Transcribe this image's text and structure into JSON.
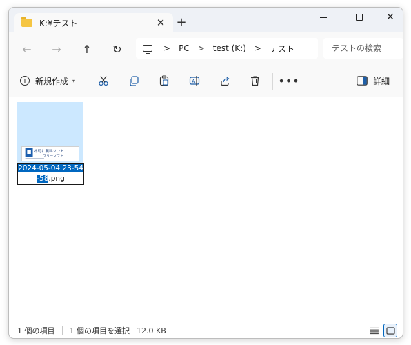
{
  "window": {
    "tab_title": "K:¥テスト",
    "close_tab_glyph": "✕",
    "new_tab_glyph": "+"
  },
  "nav": {
    "back_glyph": "←",
    "forward_glyph": "→",
    "up_glyph": "↑",
    "refresh_glyph": "↻",
    "breadcrumbs": [
      "PC",
      "test (K:)",
      "テスト"
    ],
    "separator": ">",
    "search_placeholder": "テストの検索"
  },
  "toolbar": {
    "new_label": "新規作成",
    "more_glyph": "•••",
    "details_label": "詳細"
  },
  "file": {
    "name_selected": "2024-05-04 23-54-58",
    "name_line1": "2024-05-04 23-54",
    "name_line2_selected": "-58",
    "name_extension": ".png",
    "thumbnail_text_1": "本町に無料ソフト",
    "thumbnail_text_2": "フリーソフト"
  },
  "status": {
    "item_count": "1 個の項目",
    "selected_info": "1 個の項目を選択",
    "size": "12.0 KB"
  },
  "colors": {
    "accent": "#0067c0",
    "selection": "#cce8ff",
    "folder": "#f5c542"
  }
}
